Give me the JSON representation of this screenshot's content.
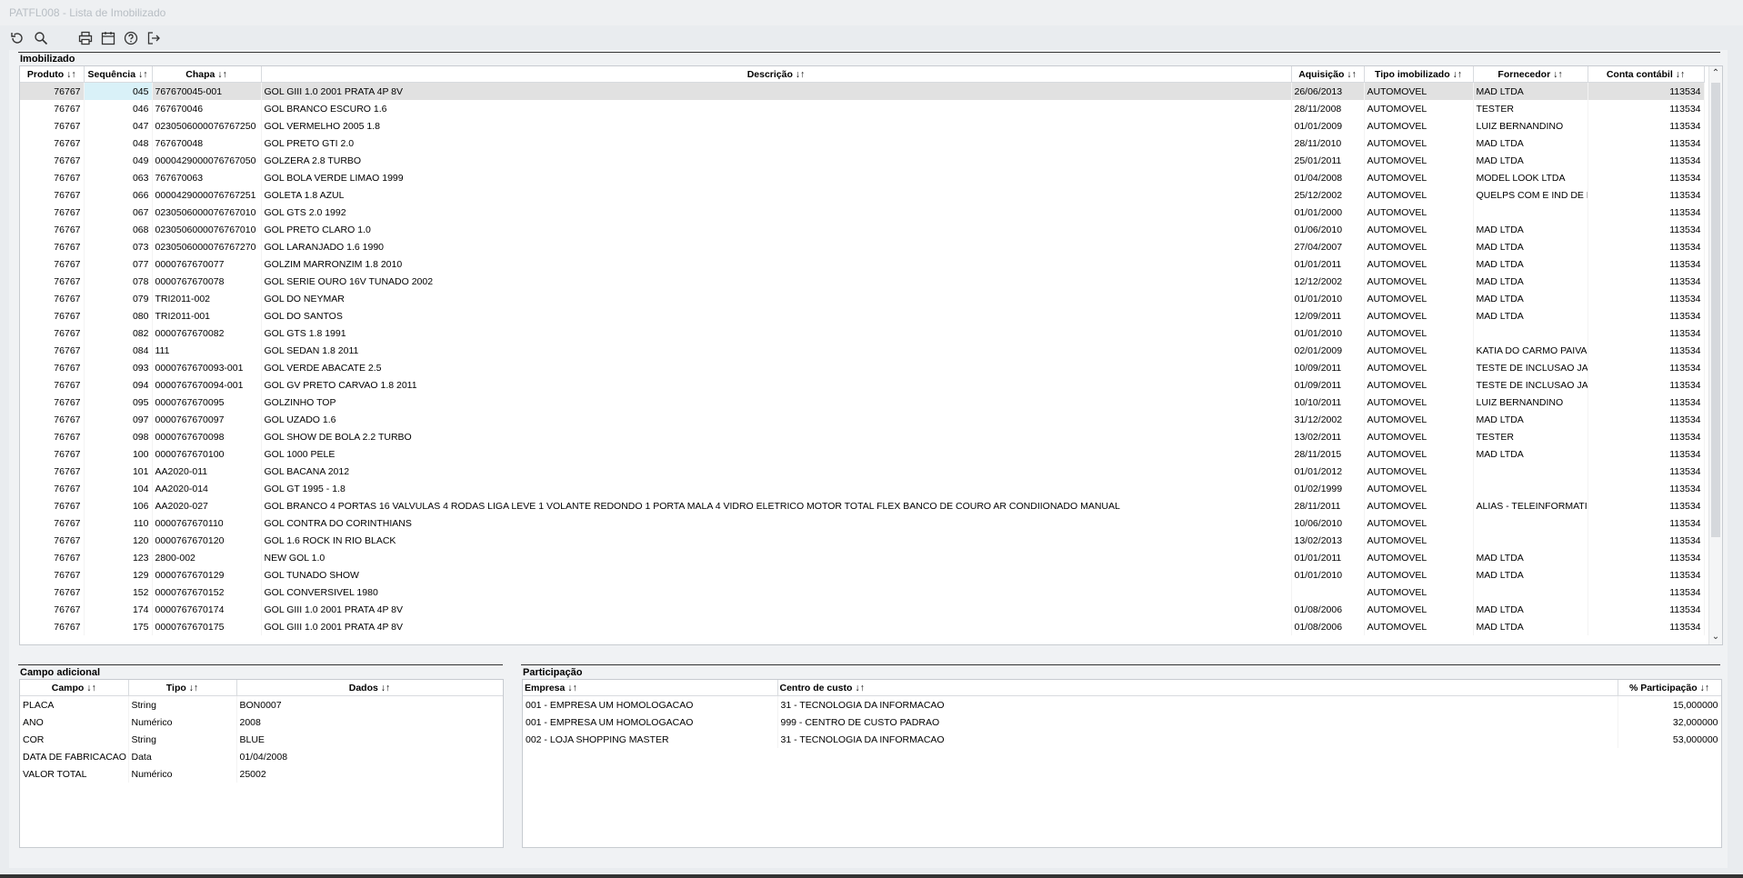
{
  "window": {
    "title": "PATFL008 - Lista de Imobilizado"
  },
  "toolbar": {
    "buttons": [
      {
        "icon": "refresh-icon",
        "label": "Atualizar"
      },
      {
        "icon": "search-icon",
        "label": "Pesquisar"
      },
      {
        "icon": "print-icon",
        "label": "Imprimir"
      },
      {
        "icon": "calendar-icon",
        "label": "Calendário"
      },
      {
        "icon": "help-icon",
        "label": "Ajuda"
      },
      {
        "icon": "exit-icon",
        "label": "Sair"
      }
    ]
  },
  "imobilizado": {
    "title": "Imobilizado",
    "columns": [
      "Produto ↓↑",
      "Sequência ↓↑",
      "Chapa ↓↑",
      "Descrição ↓↑",
      "Aquisição ↓↑",
      "Tipo imobilizado ↓↑",
      "Fornecedor ↓↑",
      "Conta contábil ↓↑"
    ],
    "rows": [
      [
        "76767",
        "045",
        "767670045-001",
        "GOL GIII 1.0 2001 PRATA 4P 8V",
        "26/06/2013",
        "AUTOMOVEL",
        "MAD LTDA",
        "113534"
      ],
      [
        "76767",
        "046",
        "767670046",
        "GOL BRANCO ESCURO 1.6",
        "28/11/2008",
        "AUTOMOVEL",
        "TESTER",
        "113534"
      ],
      [
        "76767",
        "047",
        "0230506000076767250",
        "GOL VERMELHO 2005 1.8",
        "01/01/2009",
        "AUTOMOVEL",
        "LUIZ BERNANDINO",
        "113534"
      ],
      [
        "76767",
        "048",
        "767670048",
        "GOL PRETO GTI 2.0",
        "28/11/2010",
        "AUTOMOVEL",
        "MAD LTDA",
        "113534"
      ],
      [
        "76767",
        "049",
        "0000429000076767050",
        "GOLZERA 2.8 TURBO",
        "25/01/2011",
        "AUTOMOVEL",
        "MAD LTDA",
        "113534"
      ],
      [
        "76767",
        "063",
        "767670063",
        "GOL BOLA VERDE LIMAO 1999",
        "01/04/2008",
        "AUTOMOVEL",
        "MODEL LOOK LTDA",
        "113534"
      ],
      [
        "76767",
        "066",
        "0000429000076767251",
        "GOLETA 1.8 AZUL",
        "25/12/2002",
        "AUTOMOVEL",
        "QUELPS COM E IND DE EM",
        "113534"
      ],
      [
        "76767",
        "067",
        "0230506000076767010",
        "GOL GTS 2.0 1992",
        "01/01/2000",
        "AUTOMOVEL",
        "",
        "113534"
      ],
      [
        "76767",
        "068",
        "0230506000076767010",
        "GOL PRETO CLARO 1.0",
        "01/06/2010",
        "AUTOMOVEL",
        "MAD LTDA",
        "113534"
      ],
      [
        "76767",
        "073",
        "0230506000076767270",
        "GOL LARANJADO 1.6 1990",
        "27/04/2007",
        "AUTOMOVEL",
        "MAD LTDA",
        "113534"
      ],
      [
        "76767",
        "077",
        "0000767670077",
        "GOLZIM MARRONZIM 1.8 2010",
        "01/01/2011",
        "AUTOMOVEL",
        "MAD LTDA",
        "113534"
      ],
      [
        "76767",
        "078",
        "0000767670078",
        "GOL SERIE OURO 16V TUNADO 2002",
        "12/12/2002",
        "AUTOMOVEL",
        "MAD LTDA",
        "113534"
      ],
      [
        "76767",
        "079",
        "TRI2011-002",
        "GOL DO NEYMAR",
        "01/01/2010",
        "AUTOMOVEL",
        "MAD LTDA",
        "113534"
      ],
      [
        "76767",
        "080",
        "TRI2011-001",
        "GOL DO SANTOS",
        "12/09/2011",
        "AUTOMOVEL",
        "MAD LTDA",
        "113534"
      ],
      [
        "76767",
        "082",
        "0000767670082",
        "GOL GTS 1.8 1991",
        "01/01/2010",
        "AUTOMOVEL",
        "",
        "113534"
      ],
      [
        "76767",
        "084",
        "111",
        "GOL SEDAN 1.8 2011",
        "02/01/2009",
        "AUTOMOVEL",
        "KATIA DO CARMO PAIVA",
        "113534"
      ],
      [
        "76767",
        "093",
        "0000767670093-001",
        "GOL VERDE ABACATE 2.5",
        "10/09/2011",
        "AUTOMOVEL",
        "TESTE DE INCLUSAO JAVA",
        "113534"
      ],
      [
        "76767",
        "094",
        "0000767670094-001",
        "GOL GV PRETO CARVAO 1.8 2011",
        "01/09/2011",
        "AUTOMOVEL",
        "TESTE DE INCLUSAO JAVA",
        "113534"
      ],
      [
        "76767",
        "095",
        "0000767670095",
        "GOLZINHO TOP",
        "10/10/2011",
        "AUTOMOVEL",
        "LUIZ BERNANDINO",
        "113534"
      ],
      [
        "76767",
        "097",
        "0000767670097",
        "GOL UZADO 1.6",
        "31/12/2002",
        "AUTOMOVEL",
        "MAD LTDA",
        "113534"
      ],
      [
        "76767",
        "098",
        "0000767670098",
        "GOL SHOW DE BOLA 2.2 TURBO",
        "13/02/2011",
        "AUTOMOVEL",
        "TESTER",
        "113534"
      ],
      [
        "76767",
        "100",
        "0000767670100",
        "GOL 1000 PELE",
        "28/11/2015",
        "AUTOMOVEL",
        "MAD LTDA",
        "113534"
      ],
      [
        "76767",
        "101",
        "AA2020-011",
        "GOL BACANA 2012",
        "01/01/2012",
        "AUTOMOVEL",
        "",
        "113534"
      ],
      [
        "76767",
        "104",
        "AA2020-014",
        "GOL GT 1995 - 1.8",
        "01/02/1999",
        "AUTOMOVEL",
        "",
        "113534"
      ],
      [
        "76767",
        "106",
        "AA2020-027",
        "GOL BRANCO 4 PORTAS 16 VALVULAS 4 RODAS LIGA LEVE 1 VOLANTE REDONDO 1 PORTA MALA 4 VIDRO ELETRICO MOTOR TOTAL FLEX BANCO DE COURO AR CONDIIONADO MANUAL",
        "28/11/2011",
        "AUTOMOVEL",
        "ALIAS - TELEINFORMATICA",
        "113534"
      ],
      [
        "76767",
        "110",
        "0000767670110",
        "GOL CONTRA DO CORINTHIANS",
        "10/06/2010",
        "AUTOMOVEL",
        "",
        "113534"
      ],
      [
        "76767",
        "120",
        "0000767670120",
        "GOL 1.6 ROCK IN RIO BLACK",
        "13/02/2013",
        "AUTOMOVEL",
        "",
        "113534"
      ],
      [
        "76767",
        "123",
        "2800-002",
        "NEW GOL 1.0",
        "01/01/2011",
        "AUTOMOVEL",
        "MAD LTDA",
        "113534"
      ],
      [
        "76767",
        "129",
        "0000767670129",
        "GOL TUNADO SHOW",
        "01/01/2010",
        "AUTOMOVEL",
        "MAD LTDA",
        "113534"
      ],
      [
        "76767",
        "152",
        "0000767670152",
        "GOL CONVERSIVEL 1980",
        "",
        "AUTOMOVEL",
        "",
        "113534"
      ],
      [
        "76767",
        "174",
        "0000767670174",
        "GOL GIII 1.0 2001 PRATA 4P 8V",
        "01/08/2006",
        "AUTOMOVEL",
        "MAD LTDA",
        "113534"
      ],
      [
        "76767",
        "175",
        "0000767670175",
        "GOL GIII 1.0 2001 PRATA 4P 8V",
        "01/08/2006",
        "AUTOMOVEL",
        "MAD LTDA",
        "113534"
      ]
    ]
  },
  "campo_adicional": {
    "title": "Campo adicional",
    "columns": [
      "Campo ↓↑",
      "Tipo ↓↑",
      "Dados ↓↑"
    ],
    "rows": [
      [
        "PLACA",
        "String",
        "BON0007"
      ],
      [
        "ANO",
        "Numérico",
        "2008"
      ],
      [
        "COR",
        "String",
        "BLUE"
      ],
      [
        "DATA DE FABRICACAO",
        "Data",
        "01/04/2008"
      ],
      [
        "VALOR TOTAL",
        "Numérico",
        "25002"
      ]
    ]
  },
  "participacao": {
    "title": "Participação",
    "columns": [
      "Empresa ↓↑",
      "Centro de custo ↓↑",
      "% Participação ↓↑"
    ],
    "rows": [
      [
        "001 - EMPRESA UM  HOMOLOGACAO",
        "31 - TECNOLOGIA DA INFORMACAO",
        "15,000000"
      ],
      [
        "001 - EMPRESA UM  HOMOLOGACAO",
        "999 - CENTRO DE CUSTO PADRAO",
        "32,000000"
      ],
      [
        "002 - LOJA SHOPPING MASTER",
        "31 - TECNOLOGIA DA INFORMACAO",
        "53,000000"
      ]
    ]
  }
}
